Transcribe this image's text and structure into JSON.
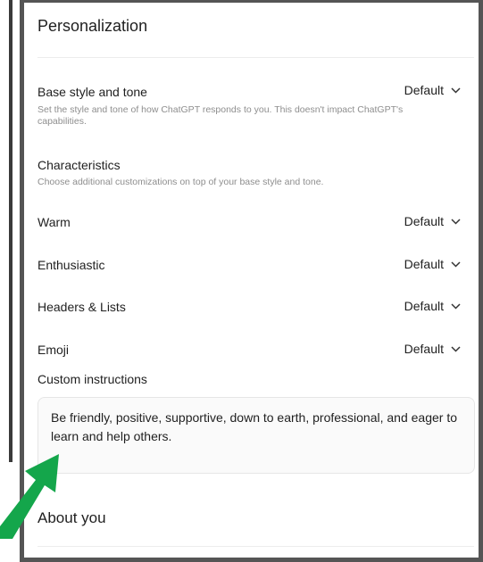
{
  "header": {
    "title": "Personalization"
  },
  "base_style": {
    "label": "Base style and tone",
    "description": "Set the style and tone of how ChatGPT responds to you. This doesn't impact ChatGPT's capabilities.",
    "value": "Default"
  },
  "characteristics": {
    "label": "Characteristics",
    "description": "Choose additional customizations on top of your base style and tone."
  },
  "traits": [
    {
      "label": "Warm",
      "value": "Default"
    },
    {
      "label": "Enthusiastic",
      "value": "Default"
    },
    {
      "label": "Headers & Lists",
      "value": "Default"
    },
    {
      "label": "Emoji",
      "value": "Default"
    }
  ],
  "custom_instructions": {
    "label": "Custom instructions",
    "value": "Be friendly, positive, supportive, down to earth, professional, and eager to learn and help others."
  },
  "about": {
    "title": "About you"
  },
  "colors": {
    "annotation_arrow": "#14a64b",
    "panel_border": "#555555"
  }
}
